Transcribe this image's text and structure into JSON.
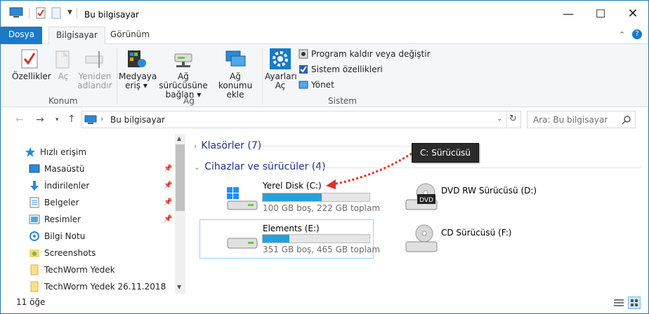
{
  "window": {
    "title": "Bu bilgisayar"
  },
  "tabs": [
    "Dosya",
    "Bilgisayar",
    "Görünüm"
  ],
  "ribbon": {
    "konum": {
      "label": "Konum",
      "buttons": [
        {
          "label1": "Özellikler",
          "label2": ""
        },
        {
          "label1": "Aç",
          "label2": ""
        },
        {
          "label1": "Yeniden",
          "label2": "adlandır"
        }
      ]
    },
    "ag": {
      "label": "Ağ",
      "buttons": [
        {
          "label1": "Medyaya",
          "label2": "eriş"
        },
        {
          "label1": "Ağ sürücüsüne",
          "label2": "bağlan"
        },
        {
          "label1": "Ağ konumu",
          "label2": "ekle"
        }
      ]
    },
    "sistem": {
      "label": "Sistem",
      "buttons": [
        {
          "label1": "Ayarları",
          "label2": "Aç"
        }
      ],
      "small": [
        "Program kaldır veya değiştir",
        "Sistem özellikleri",
        "Yönet"
      ]
    }
  },
  "address": {
    "path": "Bu bilgisayar",
    "search_placeholder": "Ara: Bu bilgisayar"
  },
  "nav": [
    {
      "label": "Hızlı erişim",
      "icon": "star-icon"
    },
    {
      "label": "Masaüstü",
      "icon": "desktop-icon"
    },
    {
      "label": "İndirilenler",
      "icon": "download-icon"
    },
    {
      "label": "Belgeler",
      "icon": "document-icon"
    },
    {
      "label": "Resimler",
      "icon": "pictures-icon"
    },
    {
      "label": "Bilgi Notu",
      "icon": "onenote-icon"
    },
    {
      "label": "Screenshots",
      "icon": "folder-screenshots-icon"
    },
    {
      "label": "TechWorm Yedek",
      "icon": "folder-icon"
    },
    {
      "label": "TechWorm Yedek 26.11.2018",
      "icon": "folder-icon"
    }
  ],
  "sections": {
    "folders": "Klasörler (7)",
    "devices": "Cihazlar ve sürücüler (4)"
  },
  "drives": [
    {
      "name": "Yerel Disk (C:)",
      "sub": "100 GB boş, 222 GB toplam",
      "used_fraction": 0.55
    },
    {
      "name": "Elements (E:)",
      "sub": "351 GB boş, 465 GB toplam",
      "used_fraction": 0.25
    },
    {
      "name": "DVD RW Sürücüsü (D:)",
      "badge": "DVD"
    },
    {
      "name": "CD Sürücüsü (F:)"
    }
  ],
  "tooltip": "C: Sürücüsü",
  "status": {
    "count": "11 öğe"
  },
  "colors": {
    "accent": "#1979ca",
    "progress": "#26a0da",
    "arrow": "#e0312a"
  }
}
